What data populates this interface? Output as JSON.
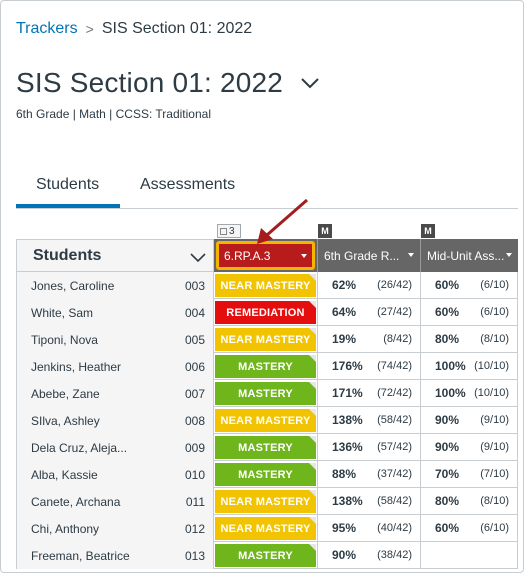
{
  "breadcrumb": {
    "parent": "Trackers",
    "separator": ">",
    "current": "SIS Section 01: 2022"
  },
  "header": {
    "title": "SIS Section 01: 2022",
    "subtitle": "6th Grade  |  Math  |  CCSS: Traditional"
  },
  "tabs": [
    {
      "label": "Students",
      "active": true
    },
    {
      "label": "Assessments",
      "active": false
    }
  ],
  "grid": {
    "badges": {
      "outcome_count": "3",
      "assessment_1": "M",
      "assessment_2": "M"
    },
    "columns": {
      "students": "Students",
      "outcome": "6.RP.A.3",
      "assessment_1": "6th Grade R...",
      "assessment_2": "Mid-Unit Ass..."
    },
    "rows": [
      {
        "name": "Jones, Caroline",
        "id": "003",
        "status": "NEAR MASTERY",
        "a1_pct": "62%",
        "a1_frac": "(26/42)",
        "a2_pct": "60%",
        "a2_frac": "(6/10)"
      },
      {
        "name": "White, Sam",
        "id": "004",
        "status": "REMEDIATION",
        "a1_pct": "64%",
        "a1_frac": "(27/42)",
        "a2_pct": "60%",
        "a2_frac": "(6/10)"
      },
      {
        "name": "Tiponi, Nova",
        "id": "005",
        "status": "NEAR MASTERY",
        "a1_pct": "19%",
        "a1_frac": "(8/42)",
        "a2_pct": "80%",
        "a2_frac": "(8/10)"
      },
      {
        "name": "Jenkins, Heather",
        "id": "006",
        "status": "MASTERY",
        "a1_pct": "176%",
        "a1_frac": "(74/42)",
        "a2_pct": "100%",
        "a2_frac": "(10/10)"
      },
      {
        "name": "Abebe, Zane",
        "id": "007",
        "status": "MASTERY",
        "a1_pct": "171%",
        "a1_frac": "(72/42)",
        "a2_pct": "100%",
        "a2_frac": "(10/10)"
      },
      {
        "name": "SIlva, Ashley",
        "id": "008",
        "status": "NEAR MASTERY",
        "a1_pct": "138%",
        "a1_frac": "(58/42)",
        "a2_pct": "90%",
        "a2_frac": "(9/10)"
      },
      {
        "name": "Dela Cruz, Aleja...",
        "id": "009",
        "status": "MASTERY",
        "a1_pct": "136%",
        "a1_frac": "(57/42)",
        "a2_pct": "90%",
        "a2_frac": "(9/10)"
      },
      {
        "name": "Alba, Kassie",
        "id": "010",
        "status": "MASTERY",
        "a1_pct": "88%",
        "a1_frac": "(37/42)",
        "a2_pct": "70%",
        "a2_frac": "(7/10)"
      },
      {
        "name": "Canete, Archana",
        "id": "011",
        "status": "NEAR MASTERY",
        "a1_pct": "138%",
        "a1_frac": "(58/42)",
        "a2_pct": "80%",
        "a2_frac": "(8/10)"
      },
      {
        "name": "Chi, Anthony",
        "id": "012",
        "status": "NEAR MASTERY",
        "a1_pct": "95%",
        "a1_frac": "(40/42)",
        "a2_pct": "60%",
        "a2_frac": "(6/10)"
      },
      {
        "name": "Freeman, Beatrice",
        "id": "013",
        "status": "MASTERY",
        "a1_pct": "90%",
        "a1_frac": "(38/42)",
        "a2_pct": "",
        "a2_frac": ""
      }
    ]
  },
  "colors": {
    "link": "#0374b5",
    "near_mastery": "#f2c300",
    "remediation": "#e50e0e",
    "mastery": "#6fb61d",
    "outcome_header": "#b81b1b",
    "outcome_highlight": "#f4b400",
    "annotation_arrow": "#a51c1c"
  },
  "icons": {
    "breadcrumb_separator": "chevron-right-icon",
    "title_menu": "chevron-down-icon",
    "students_sort": "chevron-down-icon",
    "column_menu": "caret-down-icon",
    "annotation": "red-arrow-icon"
  }
}
